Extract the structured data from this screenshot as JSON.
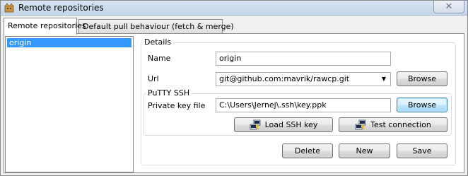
{
  "window": {
    "title": "Remote repositories",
    "close_glyph": "✕"
  },
  "tabs": [
    {
      "label": "Remote repositories",
      "active": true
    },
    {
      "label": "Default pull behaviour (fetch & merge)",
      "active": false
    }
  ],
  "remotes": {
    "items": [
      "origin"
    ],
    "selected": "origin"
  },
  "details": {
    "legend": "Details",
    "name_label": "Name",
    "name_value": "origin",
    "url_label": "Url",
    "url_value": "git@github.com:mavrik/rawcp.git",
    "browse_label": "Browse"
  },
  "putty": {
    "legend": "PuTTY SSH",
    "key_label": "Private key file",
    "key_value": "C:\\Users\\Jernej\\.ssh\\key.ppk",
    "browse_label": "Browse",
    "load_key_label": "Load SSH key",
    "test_label": "Test connection",
    "icon": "putty-icon"
  },
  "actions": {
    "delete_label": "Delete",
    "new_label": "New",
    "save_label": "Save"
  }
}
